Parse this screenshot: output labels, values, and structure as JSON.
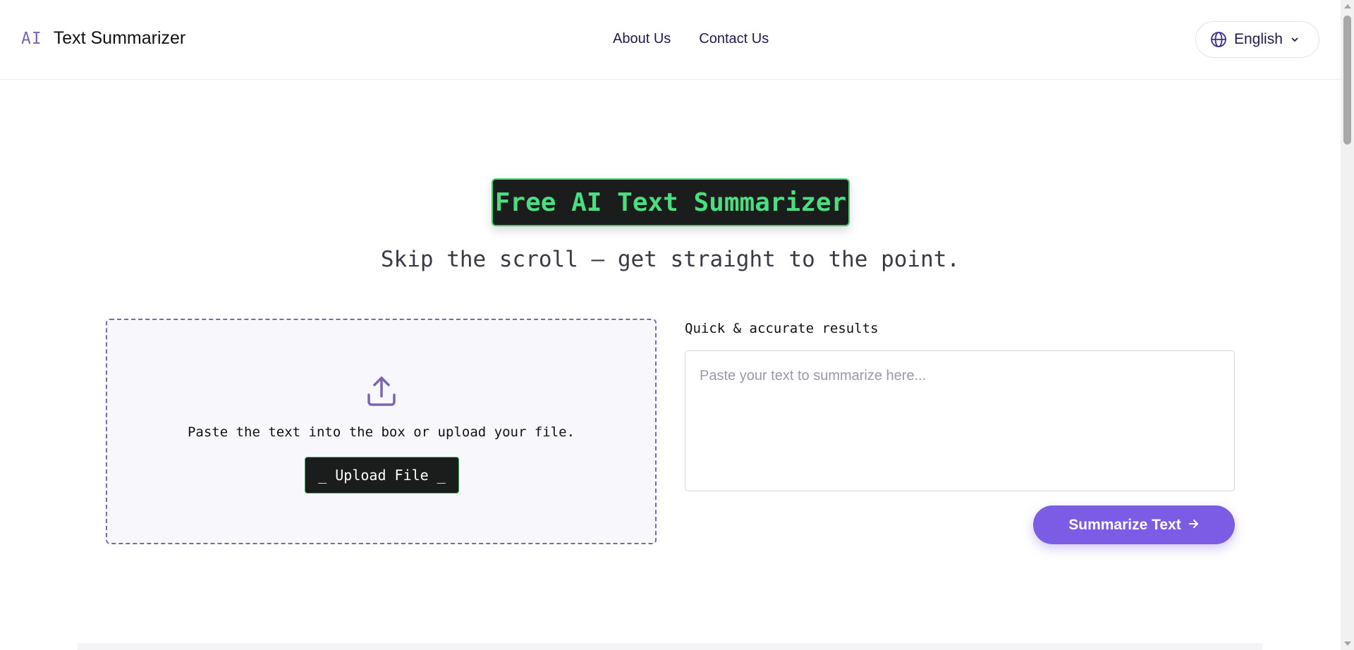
{
  "header": {
    "logo_mark": "AI",
    "logo_text": "Text Summarizer",
    "nav": [
      {
        "label": "About Us"
      },
      {
        "label": "Contact Us"
      }
    ],
    "language": {
      "selected": "English",
      "icon": "globe-icon"
    }
  },
  "hero": {
    "badge": "Free AI Text Summarizer",
    "subtitle": "Skip the scroll — get straight to the point."
  },
  "upload": {
    "icon": "upload-icon",
    "hint": "Paste the text into the box or upload your file.",
    "button_label": "_ Upload File _"
  },
  "editor": {
    "label": "Quick & accurate results",
    "placeholder": "Paste your text to summarize here...",
    "value": "",
    "submit_label": "Summarize Text",
    "submit_icon": "arrow-right-icon"
  },
  "colors": {
    "accent_purple": "#7b5ce5",
    "logo_purple": "#7b65b3",
    "badge_green": "#4ade80",
    "badge_bg": "#1b1d1c"
  }
}
